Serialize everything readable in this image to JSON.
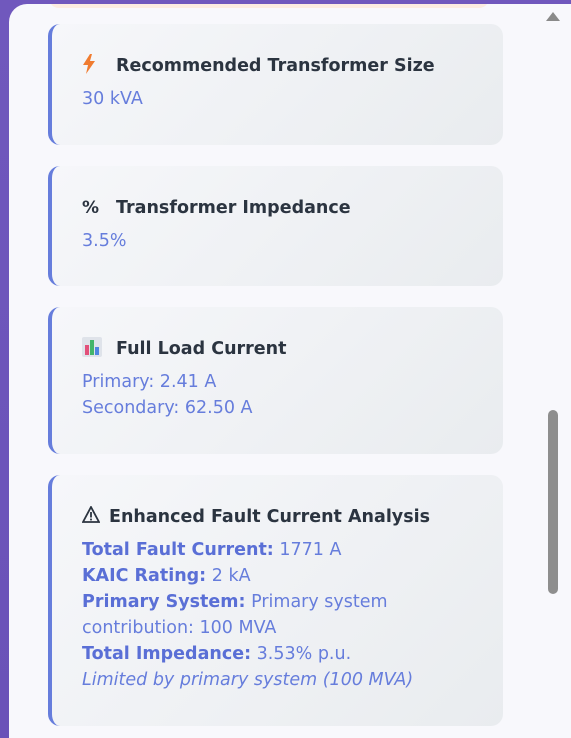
{
  "cards": [
    {
      "icon": "⚡",
      "icon_name": "lightning-icon",
      "title": "Recommended Transformer Size",
      "lines": [
        {
          "text": "30 kVA"
        }
      ]
    },
    {
      "icon": "%",
      "icon_name": "percent-icon",
      "title": "Transformer Impedance",
      "lines": [
        {
          "text": "3.5%"
        }
      ]
    },
    {
      "icon": "📊",
      "icon_name": "bar-chart-icon",
      "title": "Full Load Current",
      "lines": [
        {
          "text": "Primary: 2.41 A"
        },
        {
          "text": "Secondary: 62.50 A"
        }
      ]
    },
    {
      "icon": "⚠",
      "icon_name": "warning-icon",
      "title": "Enhanced Fault Current Analysis",
      "fault": {
        "total_fault_label": "Total Fault Current:",
        "total_fault_value": "1771 A",
        "kaic_label": "KAIC Rating:",
        "kaic_value": "2 kA",
        "primary_label": "Primary System:",
        "primary_value_1": "Primary system",
        "primary_value_2": "contribution: 100 MVA",
        "impedance_label": "Total Impedance:",
        "impedance_value": "3.53% p.u.",
        "note": "Limited by primary system (100 MVA)"
      }
    }
  ],
  "colors": {
    "accent": "#667ddc",
    "title": "#2b3440",
    "background": "#6e56bb"
  }
}
